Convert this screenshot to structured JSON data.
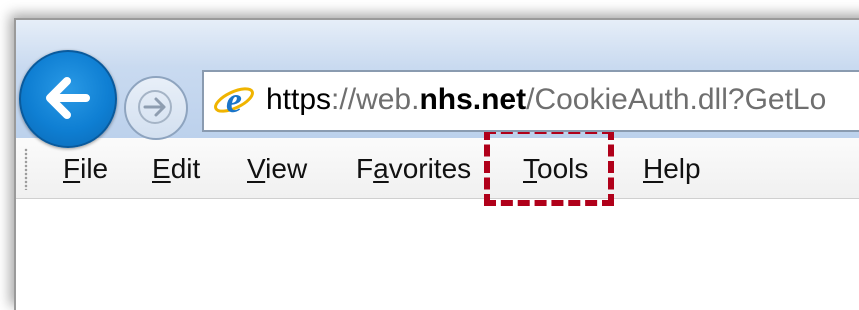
{
  "address_bar": {
    "url_scheme": "https",
    "url_separator": "://",
    "url_subdomain": "web.",
    "url_domain": "nhs.net",
    "url_path": "/CookieAuth.dll?GetLo"
  },
  "menu": {
    "items": [
      {
        "label": "File",
        "accel": "F",
        "rest": "ile"
      },
      {
        "label": "Edit",
        "accel": "E",
        "rest": "dit"
      },
      {
        "label": "View",
        "accel": "V",
        "rest": "iew"
      },
      {
        "label": "Favorites",
        "pre": "F",
        "accel": "a",
        "rest": "vorites"
      },
      {
        "label": "Tools",
        "accel": "T",
        "rest": "ools"
      },
      {
        "label": "Help",
        "accel": "H",
        "rest": "elp"
      }
    ],
    "highlighted": "Tools"
  },
  "colors": {
    "highlight_border": "#b0001a",
    "back_button": "#0f7fd3"
  },
  "icons": [
    "back-arrow-icon",
    "forward-arrow-icon",
    "internet-explorer-icon"
  ]
}
